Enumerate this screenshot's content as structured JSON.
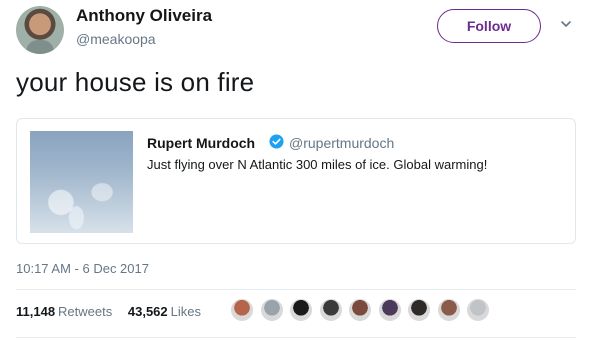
{
  "author": {
    "name": "Anthony Oliveira",
    "handle": "@meakoopa"
  },
  "header": {
    "follow_label": "Follow",
    "caret_icon": "chevron-down-icon"
  },
  "tweet": {
    "text": "your house is on fire",
    "timestamp": "10:17 AM - 6 Dec 2017"
  },
  "quoted_tweet": {
    "author_name": "Rupert Murdoch",
    "verified_icon": "verified-badge-icon",
    "author_handle": "@rupertmurdoch",
    "text": "Just flying over N Atlantic 300 miles of ice.  Global warming!"
  },
  "stats": {
    "retweets_count": "11,148",
    "retweets_label": "Retweets",
    "likes_count": "43,562",
    "likes_label": "Likes"
  },
  "likers": [
    {
      "color": "#b5654a"
    },
    {
      "color": "#9aa3ab"
    },
    {
      "color": "#1a1a1a"
    },
    {
      "color": "#3a3a3a"
    },
    {
      "color": "#7a4a3c"
    },
    {
      "color": "#4b3a5a"
    },
    {
      "color": "#2f2a28"
    },
    {
      "color": "#8a5a4a"
    },
    {
      "color": "#c0c4c8"
    }
  ],
  "colors": {
    "accent": "#6a2c91",
    "verified": "#1da1f2",
    "secondary_text": "#657786"
  }
}
